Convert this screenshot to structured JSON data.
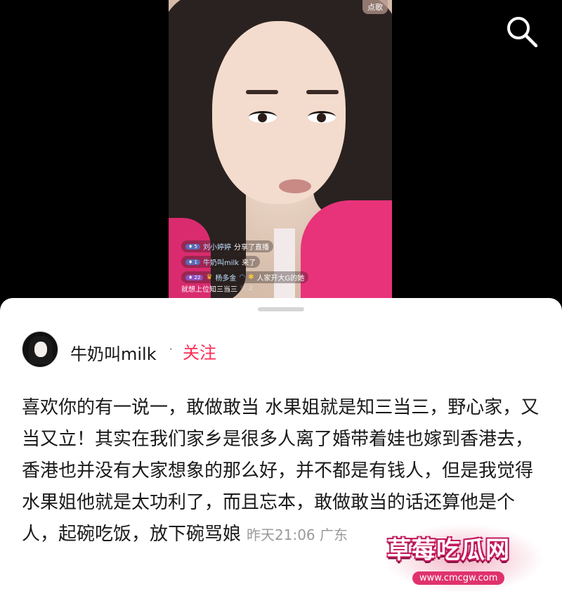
{
  "video": {
    "song_badge": "点歌",
    "chat": [
      {
        "level": "5",
        "name": "刘小婷婷",
        "text": "分享了直播"
      },
      {
        "level": "1",
        "name": "牛奶叫milk",
        "text": "来了"
      },
      {
        "level": "22",
        "name": "杨多金",
        "text": "人家开大G的她",
        "text2": "就想上位知三当三",
        "likes": "2"
      }
    ]
  },
  "comment": {
    "username": "牛奶叫milk",
    "follow_label": "关注",
    "text": "喜欢你的有一说一，敢做敢当 水果姐就是知三当三，野心家，又当又立！其实在我们家乡是很多人离了婚带着娃也嫁到香港去，香港也并没有大家想象的那么好，并不都是有钱人，但是我觉得水果姐他就是太功利了，而且忘本，敢做敢当的话还算他是个人，起碗吃饭，放下碗骂娘",
    "time": "昨天21:06",
    "location": "广东"
  },
  "watermark": {
    "title": "草莓吃瓜网",
    "url": "www.cmcgw.com"
  },
  "colors": {
    "follow": "#fe2c55",
    "background": "#000000",
    "sheet": "#ffffff"
  }
}
